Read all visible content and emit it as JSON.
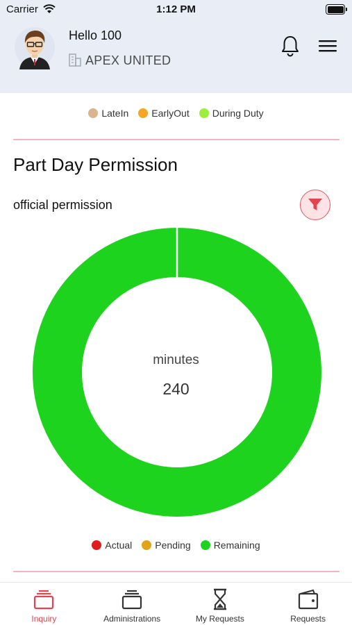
{
  "status_bar": {
    "carrier": "Carrier",
    "time": "1:12 PM"
  },
  "header": {
    "greeting": "Hello 100",
    "organization": "APEX UNITED",
    "icons": [
      "avatar",
      "building-icon",
      "bell-icon",
      "hamburger-menu-icon"
    ]
  },
  "attendance_legend": [
    {
      "label": "LateIn",
      "color": "#d9b48f"
    },
    {
      "label": "EarlyOut",
      "color": "#f5a623"
    },
    {
      "label": "During Duty",
      "color": "#9bef3a"
    }
  ],
  "section": {
    "title": "Part Day Permission",
    "subtitle": "official permission",
    "filter_icon": "filter-funnel-icon"
  },
  "chart_data": {
    "type": "pie",
    "donut": true,
    "center_label": "minutes",
    "center_value": "240",
    "series": [
      {
        "name": "Actual",
        "value": 0,
        "color": "#e11b1b"
      },
      {
        "name": "Pending",
        "value": 0,
        "color": "#e0a416"
      },
      {
        "name": "Remaining",
        "value": 240,
        "color": "#1ed31e"
      }
    ],
    "legend_placement": "bottom"
  },
  "tabs": [
    {
      "label": "Inquiry",
      "icon": "inbox-stack-icon",
      "active": true
    },
    {
      "label": "Administrations",
      "icon": "cards-stack-icon",
      "active": false
    },
    {
      "label": "My Requests",
      "icon": "hourglass-icon",
      "active": false
    },
    {
      "label": "Requests",
      "icon": "wallet-icon",
      "active": false
    }
  ],
  "colors": {
    "accent": "#e0454f",
    "header_bg": "#e9eef6",
    "divider": "#f3b6bd"
  }
}
